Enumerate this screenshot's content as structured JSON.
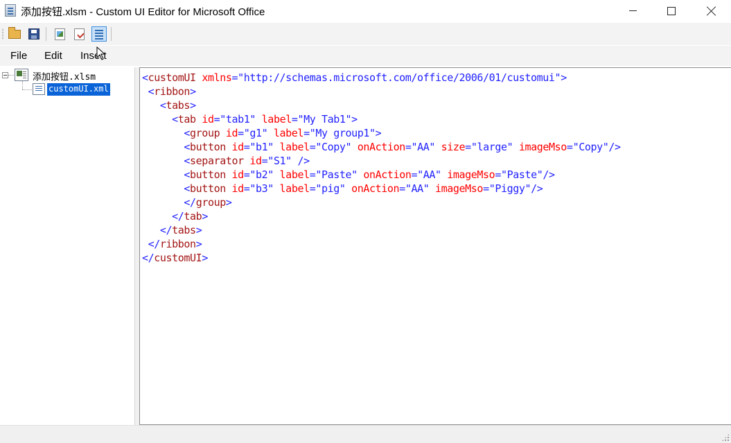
{
  "window": {
    "title": "添加按钮.xlsm - Custom UI Editor for Microsoft Office",
    "app_icon": "document-icon",
    "controls": {
      "minimize_icon": "minimize-icon",
      "maximize_icon": "maximize-icon",
      "close_icon": "close-icon"
    }
  },
  "toolbar": {
    "buttons": [
      {
        "icon": "open-folder-icon"
      },
      {
        "icon": "save-icon"
      },
      {
        "icon": "insert-image-icon"
      },
      {
        "icon": "validate-icon"
      },
      {
        "icon": "generate-callbacks-icon",
        "active": true
      }
    ]
  },
  "menu": {
    "items": [
      "File",
      "Edit",
      "Insert"
    ]
  },
  "tree": {
    "root_label": "添加按钮.xlsm",
    "child_label": "customUI.xml",
    "selected": "customUI.xml"
  },
  "editor": {
    "lines": [
      [
        {
          "t": "<",
          "c": "br"
        },
        {
          "t": "customUI",
          "c": "tag"
        },
        {
          "t": " xmlns",
          "c": "attr"
        },
        {
          "t": "=",
          "c": "eq"
        },
        {
          "t": "\"http://schemas.microsoft.com/office/2006/01/customui\"",
          "c": "val"
        },
        {
          "t": ">",
          "c": "br"
        }
      ],
      [
        {
          "t": " <",
          "c": "br"
        },
        {
          "t": "ribbon",
          "c": "tag"
        },
        {
          "t": ">",
          "c": "br"
        }
      ],
      [
        {
          "t": "   <",
          "c": "br"
        },
        {
          "t": "tabs",
          "c": "tag"
        },
        {
          "t": ">",
          "c": "br"
        }
      ],
      [
        {
          "t": "     <",
          "c": "br"
        },
        {
          "t": "tab",
          "c": "tag"
        },
        {
          "t": " id",
          "c": "attr"
        },
        {
          "t": "=",
          "c": "eq"
        },
        {
          "t": "\"tab1\"",
          "c": "val"
        },
        {
          "t": " label",
          "c": "attr"
        },
        {
          "t": "=",
          "c": "eq"
        },
        {
          "t": "\"My Tab1\"",
          "c": "val"
        },
        {
          "t": ">",
          "c": "br"
        }
      ],
      [
        {
          "t": "       <",
          "c": "br"
        },
        {
          "t": "group",
          "c": "tag"
        },
        {
          "t": " id",
          "c": "attr"
        },
        {
          "t": "=",
          "c": "eq"
        },
        {
          "t": "\"g1\"",
          "c": "val"
        },
        {
          "t": " label",
          "c": "attr"
        },
        {
          "t": "=",
          "c": "eq"
        },
        {
          "t": "\"My group1\"",
          "c": "val"
        },
        {
          "t": ">",
          "c": "br"
        }
      ],
      [
        {
          "t": "       <",
          "c": "br"
        },
        {
          "t": "button",
          "c": "tag"
        },
        {
          "t": " id",
          "c": "attr"
        },
        {
          "t": "=",
          "c": "eq"
        },
        {
          "t": "\"b1\"",
          "c": "val"
        },
        {
          "t": " label",
          "c": "attr"
        },
        {
          "t": "=",
          "c": "eq"
        },
        {
          "t": "\"Copy\"",
          "c": "val"
        },
        {
          "t": " onAction",
          "c": "attr"
        },
        {
          "t": "=",
          "c": "eq"
        },
        {
          "t": "\"AA\"",
          "c": "val"
        },
        {
          "t": " size",
          "c": "attr"
        },
        {
          "t": "=",
          "c": "eq"
        },
        {
          "t": "\"large\"",
          "c": "val"
        },
        {
          "t": " imageMso",
          "c": "attr"
        },
        {
          "t": "=",
          "c": "eq"
        },
        {
          "t": "\"Copy\"",
          "c": "val"
        },
        {
          "t": "/>",
          "c": "br"
        }
      ],
      [
        {
          "t": "       <",
          "c": "br"
        },
        {
          "t": "separator",
          "c": "tag"
        },
        {
          "t": " id",
          "c": "attr"
        },
        {
          "t": "=",
          "c": "eq"
        },
        {
          "t": "\"S1\"",
          "c": "val"
        },
        {
          "t": " />",
          "c": "br"
        }
      ],
      [
        {
          "t": "       <",
          "c": "br"
        },
        {
          "t": "button",
          "c": "tag"
        },
        {
          "t": " id",
          "c": "attr"
        },
        {
          "t": "=",
          "c": "eq"
        },
        {
          "t": "\"b2\"",
          "c": "val"
        },
        {
          "t": " label",
          "c": "attr"
        },
        {
          "t": "=",
          "c": "eq"
        },
        {
          "t": "\"Paste\"",
          "c": "val"
        },
        {
          "t": " onAction",
          "c": "attr"
        },
        {
          "t": "=",
          "c": "eq"
        },
        {
          "t": "\"AA\"",
          "c": "val"
        },
        {
          "t": " imageMso",
          "c": "attr"
        },
        {
          "t": "=",
          "c": "eq"
        },
        {
          "t": "\"Paste\"",
          "c": "val"
        },
        {
          "t": "/>",
          "c": "br"
        }
      ],
      [
        {
          "t": "       <",
          "c": "br"
        },
        {
          "t": "button",
          "c": "tag"
        },
        {
          "t": " id",
          "c": "attr"
        },
        {
          "t": "=",
          "c": "eq"
        },
        {
          "t": "\"b3\"",
          "c": "val"
        },
        {
          "t": " label",
          "c": "attr"
        },
        {
          "t": "=",
          "c": "eq"
        },
        {
          "t": "\"pig\"",
          "c": "val"
        },
        {
          "t": " onAction",
          "c": "attr"
        },
        {
          "t": "=",
          "c": "eq"
        },
        {
          "t": "\"AA\"",
          "c": "val"
        },
        {
          "t": " imageMso",
          "c": "attr"
        },
        {
          "t": "=",
          "c": "eq"
        },
        {
          "t": "\"Piggy\"",
          "c": "val"
        },
        {
          "t": "/>",
          "c": "br"
        }
      ],
      [
        {
          "t": "       </",
          "c": "br"
        },
        {
          "t": "group",
          "c": "tag"
        },
        {
          "t": ">",
          "c": "br"
        }
      ],
      [
        {
          "t": "     </",
          "c": "br"
        },
        {
          "t": "tab",
          "c": "tag"
        },
        {
          "t": ">",
          "c": "br"
        }
      ],
      [
        {
          "t": "   </",
          "c": "br"
        },
        {
          "t": "tabs",
          "c": "tag"
        },
        {
          "t": ">",
          "c": "br"
        }
      ],
      [
        {
          "t": " </",
          "c": "br"
        },
        {
          "t": "ribbon",
          "c": "tag"
        },
        {
          "t": ">",
          "c": "br"
        }
      ],
      [
        {
          "t": "</",
          "c": "br"
        },
        {
          "t": "customUI",
          "c": "tag"
        },
        {
          "t": ">",
          "c": "br"
        }
      ]
    ]
  },
  "colors": {
    "bracket": "#2222ff",
    "tag": "#a31515",
    "attribute": "#ff0000",
    "value": "#2222ff",
    "selection": "#0a64d8"
  }
}
